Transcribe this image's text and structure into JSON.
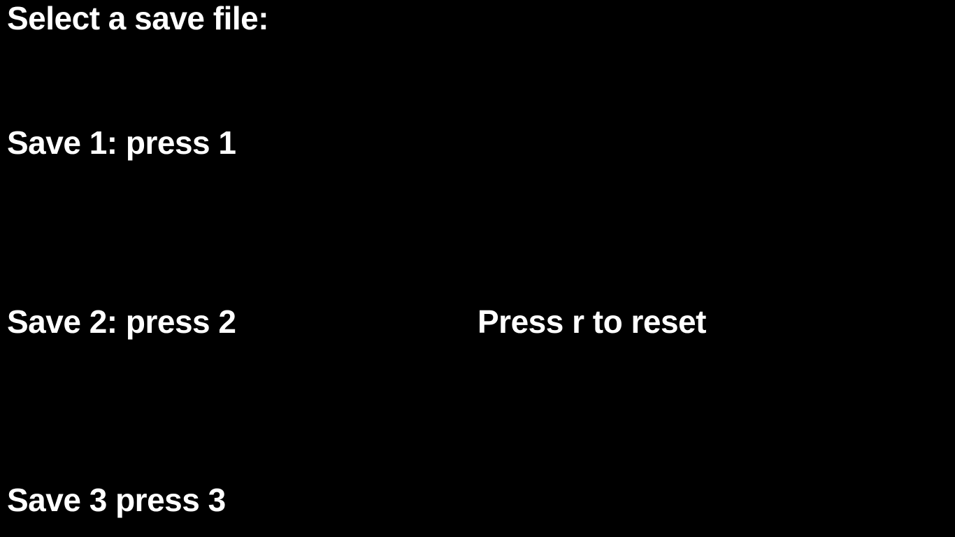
{
  "screen": {
    "title": "Select a save file:",
    "options": [
      "Save 1: press 1",
      "Save 2: press 2",
      "Save 3 press 3"
    ],
    "reset_hint": "Press r to reset"
  },
  "colors": {
    "background": "#000000",
    "text": "#ffffff"
  }
}
